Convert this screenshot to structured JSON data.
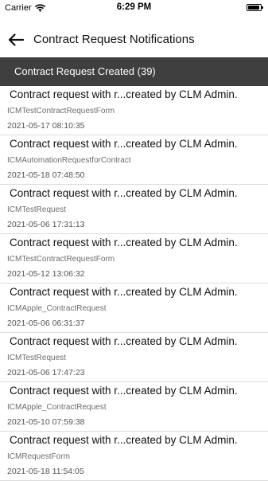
{
  "status_bar": {
    "carrier": "Carrier",
    "time": "6:29 PM"
  },
  "nav": {
    "title": "Contract Request Notifications",
    "back_icon": "arrow-left-icon"
  },
  "section": {
    "header": "Contract Request Created (39)"
  },
  "notifications": [
    {
      "title": "Contract request with r...created by CLM Admin.",
      "form": "ICMTestContractRequestForm",
      "timestamp": "2021-05-17 08:10:35"
    },
    {
      "title": "Contract request with r...created by CLM Admin.",
      "form": "ICMAutomationRequestforContract",
      "timestamp": "2021-05-18 07:48:50"
    },
    {
      "title": "Contract request with r...created by CLM Admin.",
      "form": "ICMTestRequest",
      "timestamp": "2021-05-06 17:31:13"
    },
    {
      "title": "Contract request with r...created by CLM Admin.",
      "form": "ICMTestContractRequestForm",
      "timestamp": "2021-05-12 13:06:32"
    },
    {
      "title": "Contract request with r...created by CLM Admin.",
      "form": "ICMApple_ContractRequest",
      "timestamp": "2021-05-06 06:31:37"
    },
    {
      "title": "Contract request with r...created by CLM Admin.",
      "form": "ICMTestRequest",
      "timestamp": "2021-05-06 17:47:23"
    },
    {
      "title": "Contract request with r...created by CLM Admin.",
      "form": "ICMApple_ContractRequest",
      "timestamp": "2021-05-10 07:59:38"
    },
    {
      "title": "Contract request with r...created by CLM Admin.",
      "form": "ICMRequestForm",
      "timestamp": "2021-05-18 11:54:05"
    }
  ]
}
